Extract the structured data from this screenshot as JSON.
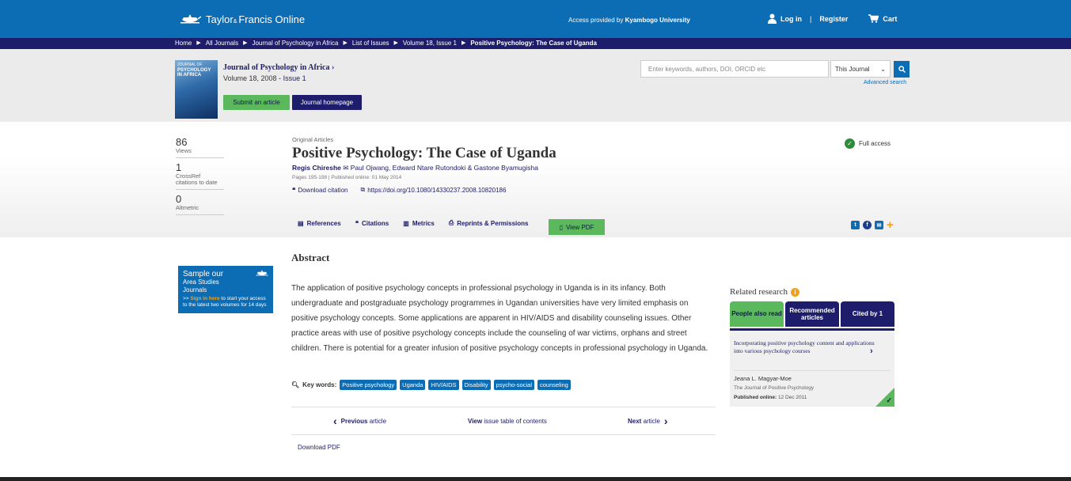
{
  "header": {
    "brand_main": "Taylor",
    "brand_amp": "& ",
    "brand_rest": "Francis Online",
    "access_prefix": "Access provided by ",
    "access_org": "Kyambogo University",
    "login": "Log in",
    "register": "Register",
    "cart": "Cart",
    "divider": "|"
  },
  "breadcrumb": [
    "Home",
    "All Journals",
    "Journal of Psychology in Africa",
    "List of Issues",
    "Volume 18, Issue 1",
    "Positive Psychology: The Case of Uganda"
  ],
  "journal": {
    "cover_small": "JOURNAL OF",
    "cover_big": "PSYCHOLOGY IN AFRICA",
    "title": "Journal of Psychology in Africa",
    "volume": "Volume 18, 2008 - ",
    "issue": "Issue 1",
    "submit_label": "Submit an article",
    "homepage_label": "Journal homepage"
  },
  "search": {
    "placeholder": "Enter keywords, authors, DOI, ORCID etc",
    "scope": "This Journal",
    "advanced": "Advanced search"
  },
  "metrics": [
    {
      "value": "86",
      "label": "Views"
    },
    {
      "value": "1",
      "label": "CrossRef citations to date"
    },
    {
      "value": "0",
      "label": "Altmetric"
    }
  ],
  "article": {
    "type": "Original Articles",
    "title": "Positive Psychology: The Case of Uganda",
    "first_author": "Regis Chireshe",
    "other_authors": "Paul Ojwang, Edward Ntare Rutondoki & Gastone Byamugisha",
    "pages": "Pages 195-198 | Published online: 01 May 2014",
    "download_citation": "Download citation",
    "doi": "https://doi.org/10.1080/14330237.2008.10820186",
    "access": "Full access"
  },
  "tabs": {
    "references": "References",
    "citations": "Citations",
    "metrics": "Metrics",
    "reprints": "Reprints & Permissions",
    "view_pdf": "View PDF"
  },
  "promo": {
    "heading": "Sample our",
    "sub1": "Area Studies",
    "sub2": "Journals",
    "link_prefix": ">> ",
    "link": "Sign in here",
    "link_rest": " to start your access to the latest two volumes for 14 days"
  },
  "abstract": {
    "heading": "Abstract",
    "text": "The application of positive psychology concepts in professional psychology in Uganda is in its infancy. Both undergraduate and postgraduate psychology programmes in Ugandan universities have very limited emphasis on positive psychology concepts. Some applications are apparent in HIV/AIDS and disability counseling issues. Other practice areas with use of positive psychology concepts include the counseling of war victims, orphans and street children. There is potential for a greater infusion of positive psychology concepts in professional psychology in Uganda.",
    "keywords_label": "Key words:",
    "keywords": [
      "Positive psychology",
      "Uganda",
      "HIV/AIDS",
      "Disability",
      "psycho-social",
      "counseling"
    ]
  },
  "pager": {
    "previous_bold": "Previous",
    "previous_rest": " article",
    "view_bold": "View",
    "view_rest": " issue table of contents",
    "next_bold": "Next",
    "next_rest": " article",
    "download_pdf": "Download PDF"
  },
  "related": {
    "heading": "Related research",
    "tab1": "People also read",
    "tab2": "Recommended articles",
    "tab3": "Cited by 1",
    "article_title": "Incorporating positive psychology content and applications into various psychology courses",
    "author": "Jeana L. Magyar-Moe",
    "journal": "The Journal of Positive Psychology",
    "published_label": "Published online:",
    "published_date": " 12 Dec 2011"
  },
  "colors": {
    "primary_blue": "#0c6cb4",
    "navy": "#1d1d6b",
    "green": "#5cb85c",
    "orange": "#f0a01e"
  }
}
